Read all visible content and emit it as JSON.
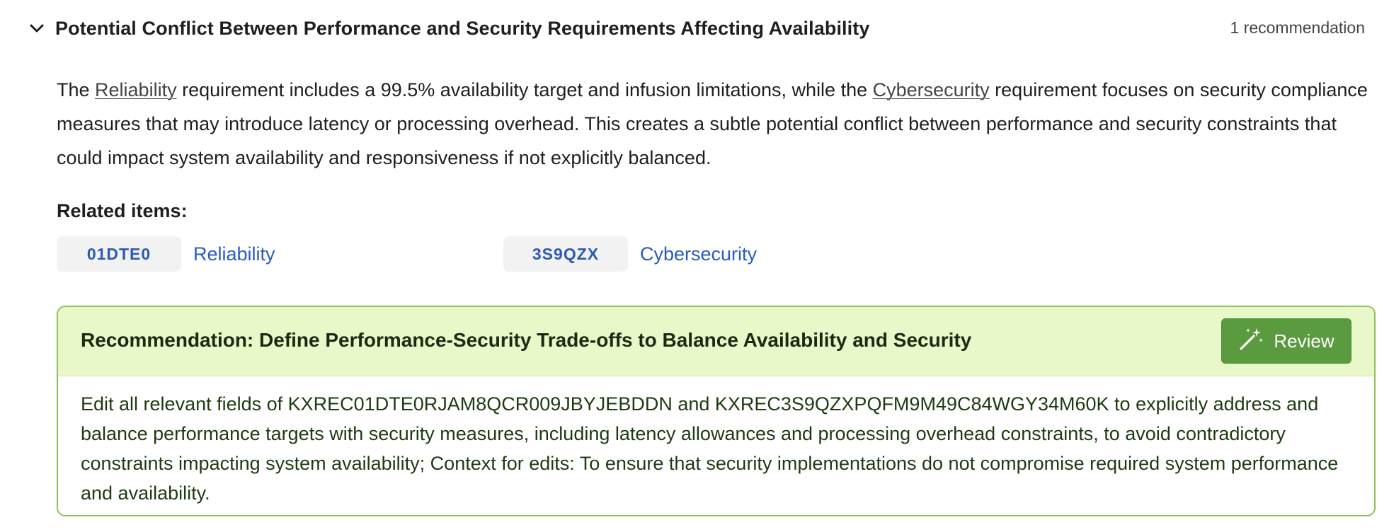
{
  "issue": {
    "title": "Potential Conflict Between Performance and Security Requirements Affecting Availability",
    "recommendation_count": "1 recommendation",
    "description": {
      "part1": "The ",
      "ref1": "Reliability",
      "part2": " requirement includes a 99.5% availability target and infusion limitations, while the ",
      "ref2": "Cybersecurity",
      "part3": " requirement focuses on security compliance measures that may introduce latency or processing overhead. This creates a subtle potential conflict between performance and security constraints that could impact system availability and responsiveness if not explicitly balanced."
    },
    "related_label": "Related items:",
    "related_items": [
      {
        "id": "01DTE0",
        "name": "Reliability"
      },
      {
        "id": "3S9QZX",
        "name": "Cybersecurity"
      }
    ]
  },
  "recommendation": {
    "title": "Recommendation: Define Performance-Security Trade-offs to Balance Availability and Security",
    "review_label": "Review",
    "body": "Edit all relevant fields of KXREC01DTE0RJAM8QCR009JBYJEBDDN and KXREC3S9QZXPQFM9M49C84WGY34M60K to explicitly address and balance performance targets with security measures, including latency allowances and processing overhead constraints, to avoid contradictory constraints impacting system availability; Context for edits: To ensure that security implementations do not compromise required system performance and availability."
  },
  "icons": {
    "collapse": "chevron-down-icon",
    "review": "magic-wand-icon"
  },
  "colors": {
    "accent_green": "#5b9b3f",
    "rec_header_bg": "#e9f8c9",
    "rec_border": "#8fc15a",
    "link_blue": "#2b5bbf"
  }
}
